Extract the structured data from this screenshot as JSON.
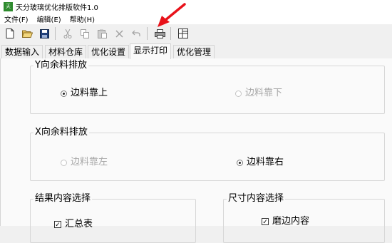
{
  "window": {
    "title": "天分玻璃优化排版软件1.0",
    "icon_text": "天分"
  },
  "menu": {
    "items": [
      "文件(F)",
      "编辑(E)",
      "帮助(H)"
    ]
  },
  "toolbar": {
    "icons": [
      "new-icon",
      "open-icon",
      "save-icon",
      "cut-icon",
      "copy-icon",
      "paste-icon",
      "delete-icon",
      "undo-icon",
      "print-icon",
      "layout-icon"
    ]
  },
  "annotation": {
    "color": "#e8121a"
  },
  "tabs": [
    "数据输入",
    "材料仓库",
    "优化设置",
    "显示打印",
    "优化管理"
  ],
  "active_tab": "显示打印",
  "y_group": {
    "title": "Y向余料排放",
    "option_top": "边料靠上",
    "option_bottom": "边料靠下",
    "selected": "边料靠上"
  },
  "x_group": {
    "title": "X向余料排放",
    "option_left": "边料靠左",
    "option_right": "边料靠右",
    "selected": "边料靠右"
  },
  "result_group": {
    "title": "结果内容选择",
    "item": "汇总表"
  },
  "size_group": {
    "title": "尺寸内容选择",
    "item": "磨边内容"
  }
}
